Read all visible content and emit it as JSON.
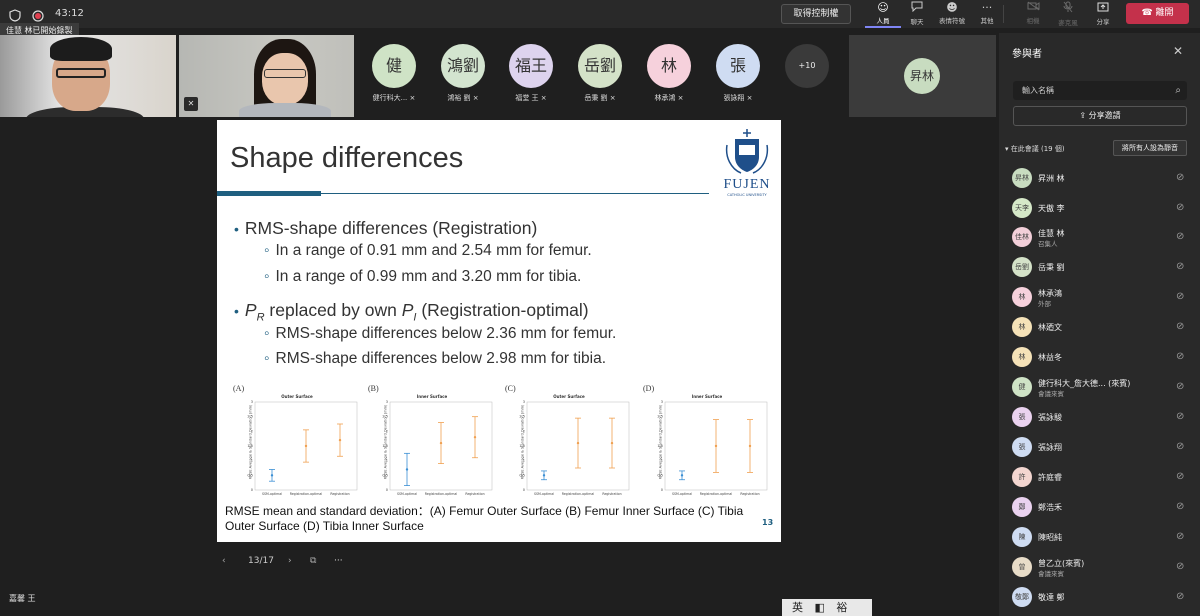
{
  "topbar": {
    "timer": "43:12",
    "control_button": "取得控制權",
    "tools": [
      {
        "icon": "people-icon",
        "glyph": "☺",
        "label": "人員"
      },
      {
        "icon": "chat-icon",
        "glyph": "💬",
        "label": "聊天"
      },
      {
        "icon": "reactions-icon",
        "glyph": "☻",
        "label": "表情符號"
      },
      {
        "icon": "more-icon",
        "glyph": "···",
        "label": "其他"
      },
      {
        "icon": "camera-off-icon",
        "glyph": "▭",
        "label": "相機"
      },
      {
        "icon": "mic-off-icon",
        "glyph": "🎙",
        "label": "麥克風"
      },
      {
        "icon": "share-icon",
        "glyph": "⇪",
        "label": "分享"
      }
    ],
    "leave_button": "離開"
  },
  "tooltip": "佳慧 林已開始錄製",
  "gallery": {
    "avatars": [
      {
        "initials": "健",
        "name": "健行科大...",
        "color": "#cfe3c6"
      },
      {
        "initials": "鴻劉",
        "name": "鴻裕 劉",
        "color": "#d3e4cf"
      },
      {
        "initials": "福王",
        "name": "福堂 王",
        "color": "#ddd3ee"
      },
      {
        "initials": "岳劉",
        "name": "岳秉 劉",
        "color": "#d4e2c8"
      },
      {
        "initials": "林",
        "name": "林承鴻",
        "color": "#f6d1dc"
      },
      {
        "initials": "張",
        "name": "張詠翔",
        "color": "#cfdcf2"
      }
    ],
    "overflow": "+10",
    "big_tile": "昇林"
  },
  "slide": {
    "title": "Shape differences",
    "logo_text": "FUJEN",
    "logo_sub": "CATHOLIC UNIVERSITY",
    "bullet1": "RMS-shape differences (Registration)",
    "bullet1_sub1": "In a range of 0.91 mm and 2.54 mm for femur.",
    "bullet1_sub2": "In a range of 0.99 mm and 3.20 mm for tibia.",
    "bullet2_p1": "P",
    "bullet2_s1": "R",
    "bullet2_mid": " replaced by own ",
    "bullet2_p2": "P",
    "bullet2_s2": "I",
    "bullet2_end": " (Registration-optimal)",
    "bullet2_sub1": "RMS-shape differences below 2.36 mm for femur.",
    "bullet2_sub2": "RMS-shape differences below 2.98 mm for tibia.",
    "caption": "RMSE mean and standard deviation：(A) Femur Outer Surface (B) Femur Inner Surface (C) Tibia Outer Surface (D) Tibia Inner Surface",
    "page_number": "13"
  },
  "chart_data": [
    {
      "type": "scatter",
      "label": "(A)",
      "title": "Outer Surface",
      "ylabel": "RMSE Average & Standard Deviation (mm)",
      "categories": [
        "SSM-optimal",
        "Registration-optimal",
        "Registration"
      ],
      "ylim": [
        0,
        3
      ],
      "series": [
        {
          "name": "mean",
          "values": [
            0.5,
            1.5,
            1.7
          ]
        },
        {
          "name": "sd",
          "values": [
            0.2,
            0.55,
            0.55
          ]
        }
      ]
    },
    {
      "type": "scatter",
      "label": "(B)",
      "title": "Inner Surface",
      "ylabel": "RMSE Average & Standard Deviation (mm)",
      "categories": [
        "SSM-optimal",
        "Registration-optimal",
        "Registration"
      ],
      "ylim": [
        0,
        3
      ],
      "series": [
        {
          "name": "mean",
          "values": [
            0.7,
            1.6,
            1.8
          ]
        },
        {
          "name": "sd",
          "values": [
            0.55,
            0.7,
            0.7
          ]
        }
      ]
    },
    {
      "type": "scatter",
      "label": "(C)",
      "title": "Outer Surface",
      "ylabel": "RMSE Average & Standard Deviation (mm)",
      "categories": [
        "SSM-optimal",
        "Registration-optimal",
        "Registration"
      ],
      "ylim": [
        0,
        3
      ],
      "series": [
        {
          "name": "mean",
          "values": [
            0.5,
            1.6,
            1.6
          ]
        },
        {
          "name": "sd",
          "values": [
            0.15,
            0.85,
            0.85
          ]
        }
      ]
    },
    {
      "type": "scatter",
      "label": "(D)",
      "title": "Inner Surface",
      "ylabel": "RMSE Average & Standard Deviation (mm)",
      "categories": [
        "SSM-optimal",
        "Registration-optimal",
        "Registration"
      ],
      "ylim": [
        0,
        3
      ],
      "series": [
        {
          "name": "mean",
          "values": [
            0.5,
            1.5,
            1.5
          ]
        },
        {
          "name": "sd",
          "values": [
            0.15,
            0.9,
            0.9
          ]
        }
      ]
    }
  ],
  "slide_nav": {
    "counter": "13/17"
  },
  "bottom_name": "嘉馨 王",
  "ime": "英 ◧ 裕 ⚙",
  "participants": {
    "title": "參與者",
    "search_placeholder": "輸入名稱",
    "share_invite": "分享邀請",
    "section_label": "在此會議 (19 個)",
    "mute_all": "將所有人設為靜音",
    "list": [
      {
        "initials": "昇林",
        "name": "昇洲 林",
        "sub": "",
        "color": "#c8dcc0"
      },
      {
        "initials": "天李",
        "name": "天傲 李",
        "sub": "",
        "color": "#d5e8c8"
      },
      {
        "initials": "佳林",
        "name": "佳慧 林",
        "sub": "召集人",
        "color": "#f2cfd9"
      },
      {
        "initials": "岳劉",
        "name": "岳秉 劉",
        "sub": "",
        "color": "#d4e2c8"
      },
      {
        "initials": "林",
        "name": "林承鴻",
        "sub": "外部",
        "color": "#f6d1dc"
      },
      {
        "initials": "林",
        "name": "林廼文",
        "sub": "",
        "color": "#f5e2b8"
      },
      {
        "initials": "林",
        "name": "林益冬",
        "sub": "",
        "color": "#f5e2b8"
      },
      {
        "initials": "健",
        "name": "健行科大_詹大德... (來賓)",
        "sub": "會議來賓",
        "color": "#cfe3c6"
      },
      {
        "initials": "張",
        "name": "張詠駿",
        "sub": "",
        "color": "#ead2ef"
      },
      {
        "initials": "張",
        "name": "張詠翔",
        "sub": "",
        "color": "#cfdcf2"
      },
      {
        "initials": "許",
        "name": "許庭睿",
        "sub": "",
        "color": "#f3d6d0"
      },
      {
        "initials": "鄭",
        "name": "鄭浩禾",
        "sub": "",
        "color": "#ead2ef"
      },
      {
        "initials": "陳",
        "name": "陳昭純",
        "sub": "",
        "color": "#cfdcf2"
      },
      {
        "initials": "曾",
        "name": "曾乙立(來賓)",
        "sub": "會議來賓",
        "color": "#e8dcc8"
      },
      {
        "initials": "敬鄭",
        "name": "敬達 鄭",
        "sub": "",
        "color": "#cfdcf2"
      }
    ]
  }
}
